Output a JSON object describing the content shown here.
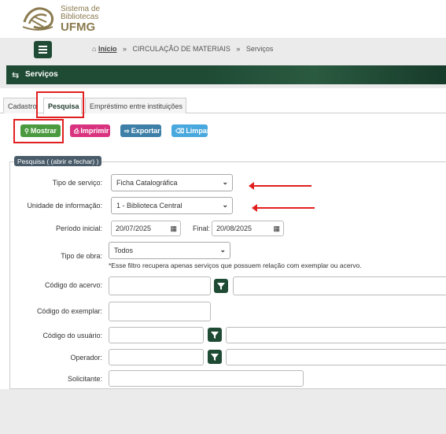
{
  "header": {
    "logo_line1": "Sistema de",
    "logo_line2": "Bibliotecas",
    "logo_line3": "UFMG"
  },
  "breadcrumb": {
    "home": "Início",
    "sep": "»",
    "level1": "CIRCULAÇÃO DE MATERIAIS",
    "level2": "Serviços"
  },
  "title": "Serviços",
  "tabs": [
    {
      "label": "Cadastro"
    },
    {
      "label": "Pesquisa"
    },
    {
      "label": "Empréstimo entre instituições"
    }
  ],
  "actions": {
    "show": "Mostrar",
    "print": "Imprimir",
    "export": "Exportar",
    "clear": "Limpar"
  },
  "filter": {
    "legend": "Pesquisa ( (abrir e fechar) )",
    "service_type_label": "Tipo de serviço:",
    "service_type_value": "Ficha Catalográfica",
    "unit_label": "Unidade de informação:",
    "unit_value": "1 - Biblioteca Central",
    "period_start_label": "Período inicial:",
    "period_start_value": "20/07/2025",
    "period_end_label": "Final:",
    "period_end_value": "20/08/2025",
    "work_type_label": "Tipo de obra:",
    "work_type_value": "Todos",
    "work_type_note": "*Esse filtro recupera apenas serviços que possuem relação com exemplar ou acervo.",
    "collection_code_label": "Código do acervo:",
    "item_code_label": "Código do exemplar:",
    "user_code_label": "Código do usuário:",
    "operator_label": "Operador:",
    "requester_label": "Solicitante:"
  },
  "colors": {
    "brand_green": "#1f4b35",
    "show_btn": "#4c9a3f",
    "print_btn": "#d9337f",
    "export_btn": "#3d7fa6",
    "clear_btn": "#49a8dd",
    "annotation_red": "#e02020"
  }
}
